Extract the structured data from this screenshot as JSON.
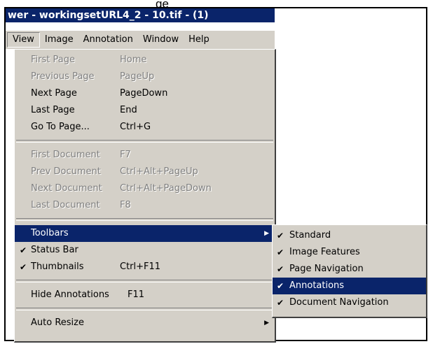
{
  "window": {
    "caption": "ge",
    "title": "wer - workingsetURL4_2 - 10.tif - (1)"
  },
  "menubar": {
    "items": [
      {
        "label": "View"
      },
      {
        "label": "Image"
      },
      {
        "label": "Annotation"
      },
      {
        "label": "Window"
      },
      {
        "label": "Help"
      }
    ]
  },
  "view_menu": {
    "group1": [
      {
        "label": "First Page",
        "shortcut": "Home",
        "enabled": false
      },
      {
        "label": "Previous Page",
        "shortcut": "PageUp",
        "enabled": false
      },
      {
        "label": "Next Page",
        "shortcut": "PageDown",
        "enabled": true
      },
      {
        "label": "Last Page",
        "shortcut": "End",
        "enabled": true
      },
      {
        "label": "Go To Page...",
        "shortcut": "Ctrl+G",
        "enabled": true
      }
    ],
    "group2": [
      {
        "label": "First Document",
        "shortcut": "F7",
        "enabled": false
      },
      {
        "label": "Prev Document",
        "shortcut": "Ctrl+Alt+PageUp",
        "enabled": false
      },
      {
        "label": "Next Document",
        "shortcut": "Ctrl+Alt+PageDown",
        "enabled": false
      },
      {
        "label": "Last Document",
        "shortcut": "F8",
        "enabled": false
      }
    ],
    "toolbars": {
      "label": "Toolbars",
      "arrow": "▶"
    },
    "status_bar": {
      "label": "Status Bar",
      "check": "✔"
    },
    "thumbnails": {
      "label": "Thumbnails",
      "shortcut": "Ctrl+F11",
      "check": "✔"
    },
    "hide_annotations": {
      "label": "Hide Annotations",
      "shortcut": "F11"
    },
    "auto_resize": {
      "label": "Auto Resize",
      "arrow": "▶"
    }
  },
  "toolbars_submenu": {
    "items": [
      {
        "label": "Standard",
        "check": "✔"
      },
      {
        "label": "Image Features",
        "check": "✔"
      },
      {
        "label": "Page Navigation",
        "check": "✔"
      },
      {
        "label": "Annotations",
        "check": "✔"
      },
      {
        "label": "Document Navigation",
        "check": "✔"
      }
    ]
  },
  "colors": {
    "titlebar": "#0a246a",
    "menu_bg": "#d4d0c8",
    "highlight": "#0a246a"
  }
}
